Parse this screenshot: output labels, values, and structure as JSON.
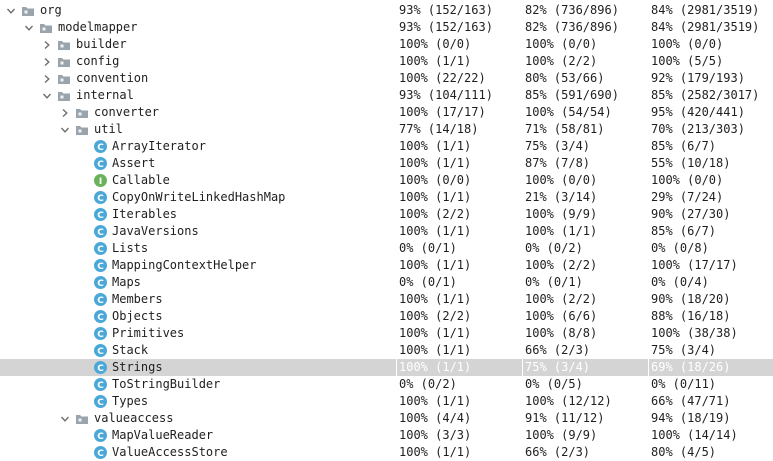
{
  "tree": {
    "rows": [
      {
        "label": "org",
        "level": 0,
        "kind": "package",
        "arrow": "expanded",
        "c1": "93% (152/163)",
        "c2": "82% (736/896)",
        "c3": "84% (2981/3519)"
      },
      {
        "label": "modelmapper",
        "level": 1,
        "kind": "package",
        "arrow": "expanded",
        "c1": "93% (152/163)",
        "c2": "82% (736/896)",
        "c3": "84% (2981/3519)"
      },
      {
        "label": "builder",
        "level": 2,
        "kind": "package",
        "arrow": "collapsed",
        "c1": "100% (0/0)",
        "c2": "100% (0/0)",
        "c3": "100% (0/0)"
      },
      {
        "label": "config",
        "level": 2,
        "kind": "package",
        "arrow": "collapsed",
        "c1": "100% (1/1)",
        "c2": "100% (2/2)",
        "c3": "100% (5/5)"
      },
      {
        "label": "convention",
        "level": 2,
        "kind": "package",
        "arrow": "collapsed",
        "c1": "100% (22/22)",
        "c2": "80% (53/66)",
        "c3": "92% (179/193)"
      },
      {
        "label": "internal",
        "level": 2,
        "kind": "package",
        "arrow": "expanded",
        "c1": "93% (104/111)",
        "c2": "85% (591/690)",
        "c3": "85% (2582/3017)"
      },
      {
        "label": "converter",
        "level": 3,
        "kind": "package",
        "arrow": "collapsed",
        "c1": "100% (17/17)",
        "c2": "100% (54/54)",
        "c3": "95% (420/441)"
      },
      {
        "label": "util",
        "level": 3,
        "kind": "package",
        "arrow": "expanded",
        "c1": "77% (14/18)",
        "c2": "71% (58/81)",
        "c3": "70% (213/303)"
      },
      {
        "label": "ArrayIterator",
        "level": 4,
        "kind": "class",
        "arrow": "none",
        "c1": "100% (1/1)",
        "c2": "75% (3/4)",
        "c3": "85% (6/7)"
      },
      {
        "label": "Assert",
        "level": 4,
        "kind": "class",
        "arrow": "none",
        "c1": "100% (1/1)",
        "c2": "87% (7/8)",
        "c3": "55% (10/18)"
      },
      {
        "label": "Callable",
        "level": 4,
        "kind": "interface",
        "arrow": "none",
        "c1": "100% (0/0)",
        "c2": "100% (0/0)",
        "c3": "100% (0/0)"
      },
      {
        "label": "CopyOnWriteLinkedHashMap",
        "level": 4,
        "kind": "class",
        "arrow": "none",
        "c1": "100% (1/1)",
        "c2": "21% (3/14)",
        "c3": "29% (7/24)"
      },
      {
        "label": "Iterables",
        "level": 4,
        "kind": "class",
        "arrow": "none",
        "c1": "100% (2/2)",
        "c2": "100% (9/9)",
        "c3": "90% (27/30)"
      },
      {
        "label": "JavaVersions",
        "level": 4,
        "kind": "class",
        "arrow": "none",
        "c1": "100% (1/1)",
        "c2": "100% (1/1)",
        "c3": "85% (6/7)"
      },
      {
        "label": "Lists",
        "level": 4,
        "kind": "class",
        "arrow": "none",
        "c1": "0% (0/1)",
        "c2": "0% (0/2)",
        "c3": "0% (0/8)"
      },
      {
        "label": "MappingContextHelper",
        "level": 4,
        "kind": "class",
        "arrow": "none",
        "c1": "100% (1/1)",
        "c2": "100% (2/2)",
        "c3": "100% (17/17)"
      },
      {
        "label": "Maps",
        "level": 4,
        "kind": "class",
        "arrow": "none",
        "c1": "0% (0/1)",
        "c2": "0% (0/1)",
        "c3": "0% (0/4)"
      },
      {
        "label": "Members",
        "level": 4,
        "kind": "class",
        "arrow": "none",
        "c1": "100% (1/1)",
        "c2": "100% (2/2)",
        "c3": "90% (18/20)"
      },
      {
        "label": "Objects",
        "level": 4,
        "kind": "class",
        "arrow": "none",
        "c1": "100% (2/2)",
        "c2": "100% (6/6)",
        "c3": "88% (16/18)"
      },
      {
        "label": "Primitives",
        "level": 4,
        "kind": "class",
        "arrow": "none",
        "c1": "100% (1/1)",
        "c2": "100% (8/8)",
        "c3": "100% (38/38)"
      },
      {
        "label": "Stack",
        "level": 4,
        "kind": "class",
        "arrow": "none",
        "c1": "100% (1/1)",
        "c2": "66% (2/3)",
        "c3": "75% (3/4)"
      },
      {
        "label": "Strings",
        "level": 4,
        "kind": "class",
        "arrow": "none",
        "selected": true,
        "c1": "100% (1/1)",
        "c2": "75% (3/4)",
        "c3": "69% (18/26)"
      },
      {
        "label": "ToStringBuilder",
        "level": 4,
        "kind": "class",
        "arrow": "none",
        "c1": "0% (0/2)",
        "c2": "0% (0/5)",
        "c3": "0% (0/11)"
      },
      {
        "label": "Types",
        "level": 4,
        "kind": "class",
        "arrow": "none",
        "c1": "100% (1/1)",
        "c2": "100% (12/12)",
        "c3": "66% (47/71)"
      },
      {
        "label": "valueaccess",
        "level": 3,
        "kind": "package",
        "arrow": "expanded",
        "c1": "100% (4/4)",
        "c2": "91% (11/12)",
        "c3": "94% (18/19)"
      },
      {
        "label": "MapValueReader",
        "level": 4,
        "kind": "class",
        "arrow": "none",
        "c1": "100% (3/3)",
        "c2": "100% (9/9)",
        "c3": "100% (14/14)"
      },
      {
        "label": "ValueAccessStore",
        "level": 4,
        "kind": "class",
        "arrow": "none",
        "c1": "100% (1/1)",
        "c2": "66% (2/3)",
        "c3": "80% (4/5)"
      }
    ]
  },
  "colors": {
    "selection": "#d4d4d4",
    "class_icon": "#4aa8d8",
    "interface_icon": "#6bb35a",
    "folder": "#9aa4ad",
    "arrow": "#6e6e6e"
  }
}
